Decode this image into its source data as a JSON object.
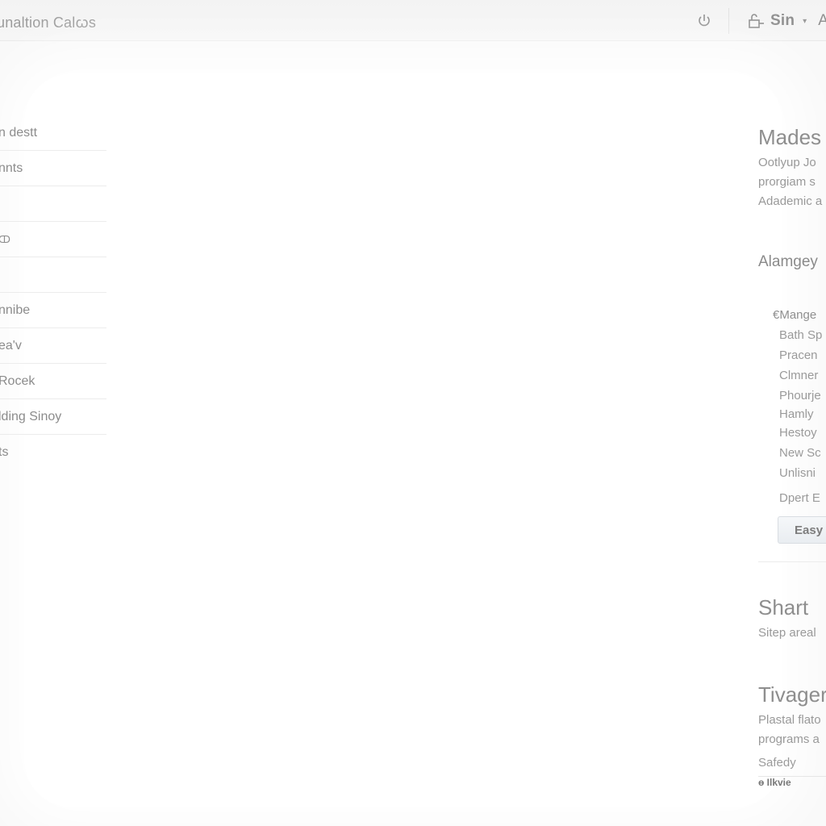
{
  "header": {
    "app_title": "unaltion Calꞷs",
    "power_icon": "power-icon",
    "user_icon": "lock-icon",
    "user_name": "Sin",
    "user_caret": "▾",
    "user_extra": "A"
  },
  "sidebar": {
    "items": [
      {
        "label": "n destt"
      },
      {
        "label": "nnts"
      },
      {
        "label": ""
      },
      {
        "label": "ↀ"
      },
      {
        "label": ""
      },
      {
        "label": "nnibe"
      },
      {
        "label": "ea'v"
      },
      {
        "label": "Rocek"
      },
      {
        "label": "lding Sinoy"
      },
      {
        "label": "ts"
      }
    ]
  },
  "right_panel": {
    "section1": {
      "title": "Mades",
      "lines": [
        "Ootlyup Jo",
        "prorgiam s",
        "Adademic a"
      ]
    },
    "section2": {
      "title": "Alamgey",
      "list": [
        "€Mange",
        "Bath Sp",
        "Pracen",
        "Clmner",
        "Phourje",
        "Hamly",
        "Hestoy",
        "New Sc",
        "Unlisni",
        "Dpert E"
      ],
      "button_label": "Easy r"
    },
    "section3": {
      "title": "Shart",
      "text": "Sitep areal"
    },
    "section4": {
      "title": "Tivager",
      "lines": [
        "Plastal flato",
        "programs a"
      ],
      "subtitle": "Safedy",
      "footer": "ө Ilkvie"
    }
  }
}
